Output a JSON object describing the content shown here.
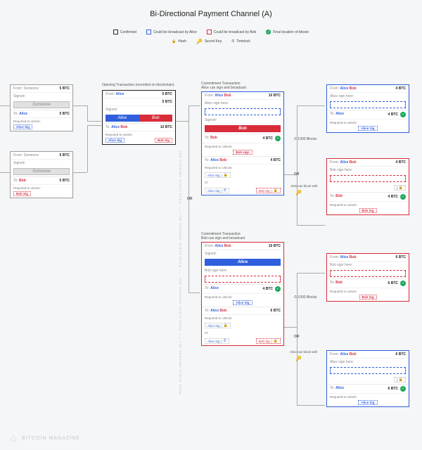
{
  "title": "Bi-Directional Payment Channel (A)",
  "legend": {
    "confirmed": "Confirmed",
    "alice": "Could be broadcast by Alice",
    "bob": "Could be broadcast by Bob",
    "final": "Final location of bitcoin",
    "hash": "Hash",
    "secret": "Secret Key",
    "timelock": "Timelock"
  },
  "labels": {
    "from": "From:",
    "to": "To:",
    "signed": "Signed:",
    "required": "Required to unlock:",
    "required2": "Required to Unlock:",
    "someone": "Someone",
    "alice": "Alice",
    "bob": "Bob",
    "alice_sig": "Alice Sig",
    "bob_sig": "Bob Sig",
    "bob_sign": "Bob sign",
    "alice_sign_here": "Alice sign here:",
    "bob_sign_here": "Bob sign here:",
    "alice_can": "Alice can sign and broadcast",
    "bob_can": "Bob can sign and broadcast",
    "bob_block": "Bob can block with",
    "alice_block": "Alice can block with",
    "blocks1000": "1000 Blocks",
    "opening": "Opening Transaction (recorded on blockchain)",
    "commit": "Commitment Transaction",
    "or": "OR",
    "or_lower": "or",
    "channel_open": "THE CHANNEL STAYS OPEN"
  },
  "amounts": {
    "five": "5 BTC",
    "ten": "10 BTC",
    "four": "4 BTC",
    "six": "6 BTC"
  },
  "watermark": "BITCOIN MAGAZINE"
}
